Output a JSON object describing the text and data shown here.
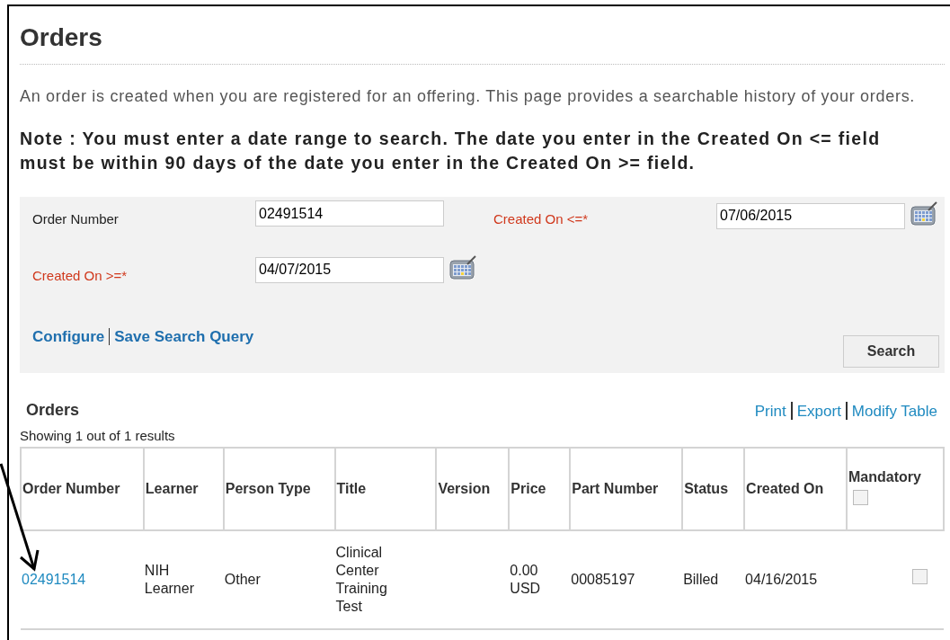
{
  "title": "Orders",
  "intro": "An order is created when you are registered for an offering. This page provides a searchable history of your orders.",
  "note": "Note : You must enter a date range to search. The date you enter in the Created On <= field must be within 90 days of the date you enter in the Created On >= field.",
  "search_form": {
    "fields": [
      {
        "label": "Order Number",
        "value": "02491514",
        "required": false,
        "calendar": false
      },
      {
        "label": "Created On <=*",
        "value": "07/06/2015",
        "required": true,
        "calendar": true
      },
      {
        "label": "Created On >=*",
        "value": "04/07/2015",
        "required": true,
        "calendar": true
      }
    ],
    "links": [
      "Configure",
      "Save Search Query"
    ],
    "button": "Search"
  },
  "results": {
    "title": "Orders",
    "count": "Showing 1 out of 1 results",
    "actions": [
      "Print",
      "Export",
      "Modify Table"
    ],
    "columns": [
      {
        "label": "Order Number",
        "kind": "text"
      },
      {
        "label": "Learner",
        "kind": "text"
      },
      {
        "label": "Person Type",
        "kind": "text"
      },
      {
        "label": "Title",
        "kind": "text"
      },
      {
        "label": "Version",
        "kind": "text"
      },
      {
        "label": "Price",
        "kind": "text"
      },
      {
        "label": "Part Number",
        "kind": "text"
      },
      {
        "label": "Status",
        "kind": "text"
      },
      {
        "label": "Created On",
        "kind": "text"
      },
      {
        "label": "Mandatory",
        "kind": "checkbox",
        "checked": false
      }
    ],
    "rows": [
      {
        "cells": [
          {
            "kind": "link",
            "text": "02491514"
          },
          {
            "kind": "text",
            "text": "NIH Learner"
          },
          {
            "kind": "text",
            "text": "Other"
          },
          {
            "kind": "text",
            "text": "Clinical Center Training Test"
          },
          {
            "kind": "text",
            "text": ""
          },
          {
            "kind": "text",
            "text": "0.00 USD"
          },
          {
            "kind": "text",
            "text": "00085197"
          },
          {
            "kind": "text",
            "text": "Billed"
          },
          {
            "kind": "text",
            "text": "04/16/2015"
          },
          {
            "kind": "checkbox",
            "checked": false
          }
        ]
      }
    ]
  }
}
